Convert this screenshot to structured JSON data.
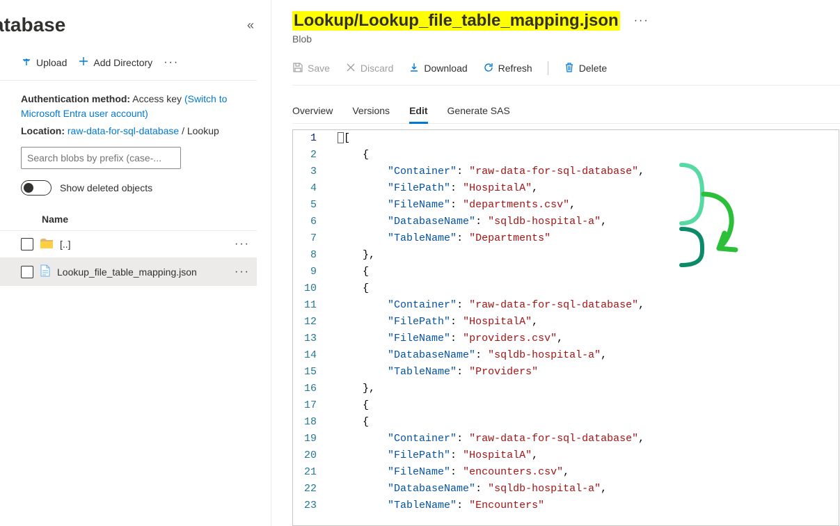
{
  "sidebar": {
    "title": "atabase",
    "upload": "Upload",
    "addDirectory": "Add Directory",
    "authLabel": "Authentication method:",
    "authValue": "Access key",
    "switchLink": "(Switch to Microsoft Entra user account)",
    "locationLabel": "Location:",
    "locationContainer": "raw-data-for-sql-database",
    "locationFolder": "Lookup",
    "searchPlaceholder": "Search blobs by prefix (case-...",
    "toggleLabel": "Show deleted objects",
    "columnName": "Name",
    "rows": [
      {
        "name": "[..]",
        "type": "folder"
      },
      {
        "name": "Lookup_file_table_mapping.json",
        "type": "file"
      }
    ]
  },
  "main": {
    "title": "Lookup/Lookup_file_table_mapping.json",
    "subtitle": "Blob",
    "toolbar": {
      "save": "Save",
      "discard": "Discard",
      "download": "Download",
      "refresh": "Refresh",
      "delete": "Delete"
    },
    "tabs": {
      "overview": "Overview",
      "versions": "Versions",
      "edit": "Edit",
      "generateSas": "Generate SAS"
    },
    "editor": {
      "records": [
        {
          "Container": "raw-data-for-sql-database",
          "FilePath": "HospitalA",
          "FileName": "departments.csv",
          "DatabaseName": "sqldb-hospital-a",
          "TableName": "Departments"
        },
        {
          "Container": "raw-data-for-sql-database",
          "FilePath": "HospitalA",
          "FileName": "providers.csv",
          "DatabaseName": "sqldb-hospital-a",
          "TableName": "Providers"
        },
        {
          "Container": "raw-data-for-sql-database",
          "FilePath": "HospitalA",
          "FileName": "encounters.csv",
          "DatabaseName": "sqldb-hospital-a",
          "TableName": "Encounters"
        }
      ],
      "keyOrder": [
        "Container",
        "FilePath",
        "FileName",
        "DatabaseName",
        "TableName"
      ],
      "visibleLines": 23
    }
  }
}
